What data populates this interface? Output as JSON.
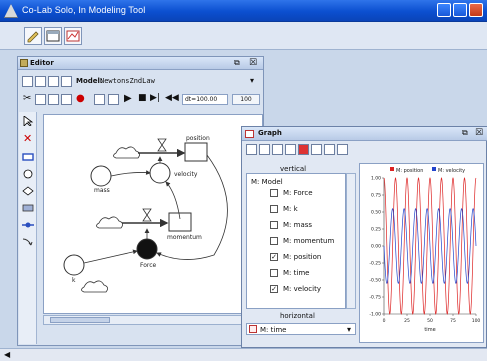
{
  "window": {
    "title": "Co-Lab Solo, In Modeling Tool"
  },
  "editor": {
    "title": "Editor",
    "model_label": "Model:",
    "model_value": "NewtonsZndLaw",
    "dt_text": "dt=100.00",
    "dt_btn": "100"
  },
  "diagram": {
    "nodes": {
      "position": "position",
      "velocity": "velocity",
      "mass": "mass",
      "momentum": "momentum",
      "force": "Force",
      "k": "k"
    }
  },
  "graph": {
    "title": "Graph",
    "vertical_label": "vertical",
    "tree_root": "M: Model",
    "variables": [
      {
        "label": "M: Force",
        "checked": false
      },
      {
        "label": "M: k",
        "checked": false
      },
      {
        "label": "M: mass",
        "checked": false
      },
      {
        "label": "M: momentum",
        "checked": false
      },
      {
        "label": "M: position",
        "checked": true
      },
      {
        "label": "M: time",
        "checked": false
      },
      {
        "label": "M: velocity",
        "checked": true
      }
    ],
    "horizontal_label": "horizontal",
    "horizontal_value": "M: time",
    "legend": [
      {
        "name": "M: position",
        "color": "#d22"
      },
      {
        "name": "M: velocity",
        "color": "#2244cc"
      }
    ],
    "y_ticks": [
      "1.00",
      "0.75",
      "0.50",
      "0.25",
      "0.00",
      "-0.25",
      "-0.50",
      "-0.75",
      "-1.00"
    ],
    "x_ticks": [
      "0",
      "25",
      "50",
      "75",
      "100"
    ],
    "x_axis_label": "time"
  },
  "chart_data": {
    "type": "line",
    "xlabel": "time",
    "ylabel": "",
    "xlim": [
      0,
      100
    ],
    "ylim": [
      -1,
      1
    ],
    "series": [
      {
        "name": "M: position",
        "color": "#d22",
        "amplitude": 1.0,
        "period": 12.5,
        "phase": 0.0
      },
      {
        "name": "M: velocity",
        "color": "#2244cc",
        "amplitude": 0.55,
        "period": 12.5,
        "phase": 1.5708
      }
    ]
  }
}
